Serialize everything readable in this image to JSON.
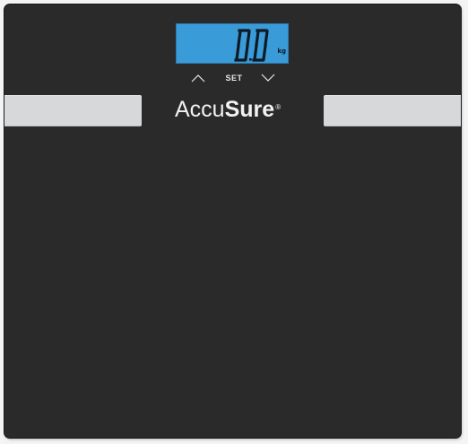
{
  "display": {
    "reading": "0.0",
    "unit": "kg"
  },
  "controls": {
    "up_icon": "chevron-up-icon",
    "set_label": "SET",
    "down_icon": "chevron-down-icon"
  },
  "brand": {
    "name_part1": "Accu",
    "name_part2": "Sure",
    "registered_mark": "®"
  },
  "colors": {
    "platform": "#2a2a2a",
    "lcd_background": "#3a9bd9",
    "lcd_segments": "#0d1a24",
    "electrodes": "#d7d8d9",
    "text": "#f2f2f2"
  }
}
